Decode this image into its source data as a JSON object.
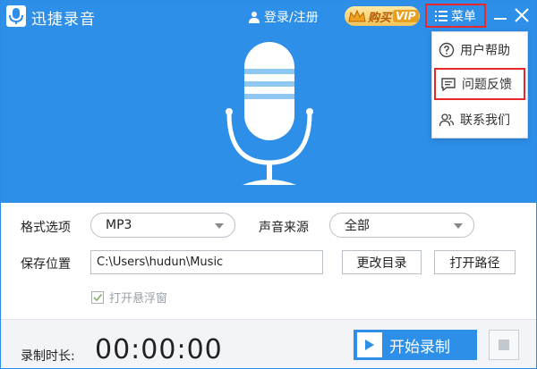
{
  "window": {
    "title": "迅捷录音",
    "login_label": "登录/注册",
    "vip_label": "购买",
    "vip_tag": "VIP",
    "menu_label": "菜单"
  },
  "menu": {
    "items": [
      {
        "label": "用户帮助",
        "icon": "help-circle-icon",
        "highlighted": false
      },
      {
        "label": "问题反馈",
        "icon": "feedback-chat-icon",
        "highlighted": true
      },
      {
        "label": "联系我们",
        "icon": "contact-users-icon",
        "highlighted": false
      }
    ]
  },
  "form": {
    "format_label": "格式选项",
    "format_value": "MP3",
    "source_label": "声音来源",
    "source_value": "全部",
    "save_label": "保存位置",
    "save_path": "C:\\Users\\hudun\\Music",
    "change_dir_label": "更改目录",
    "open_path_label": "打开路径",
    "floating_label": "打开悬浮窗",
    "floating_checked": true
  },
  "bottom": {
    "duration_label": "录制时长:",
    "timer": "00:00:00",
    "start_label": "开始录制"
  },
  "colors": {
    "brand_blue": "#2d8fe8",
    "highlight_red": "#e8282b",
    "vip_gold": "#f3c35a"
  }
}
